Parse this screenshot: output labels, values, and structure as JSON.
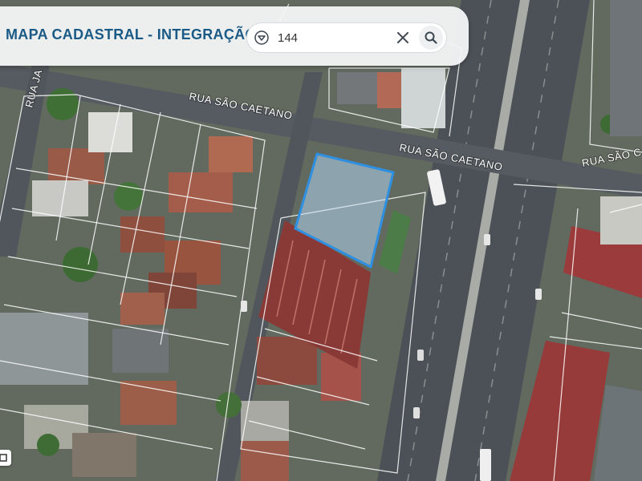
{
  "header": {
    "title": "MAPA CADASTRAL - INTEGRAÇÃO"
  },
  "search": {
    "value": "144",
    "filter_icon": "filter-dropdown-icon",
    "clear_icon": "close-icon",
    "search_icon": "search-icon"
  },
  "map": {
    "street_labels": [
      "RUA SÃO CAETANO",
      "RUA SÃO CAETANO",
      "RUA SÃO C",
      "RUA JA"
    ],
    "selection_color": "#2f8fe0",
    "parcel_line_color": "#ffffff"
  },
  "corner_control": {
    "icon": "layers-icon"
  }
}
